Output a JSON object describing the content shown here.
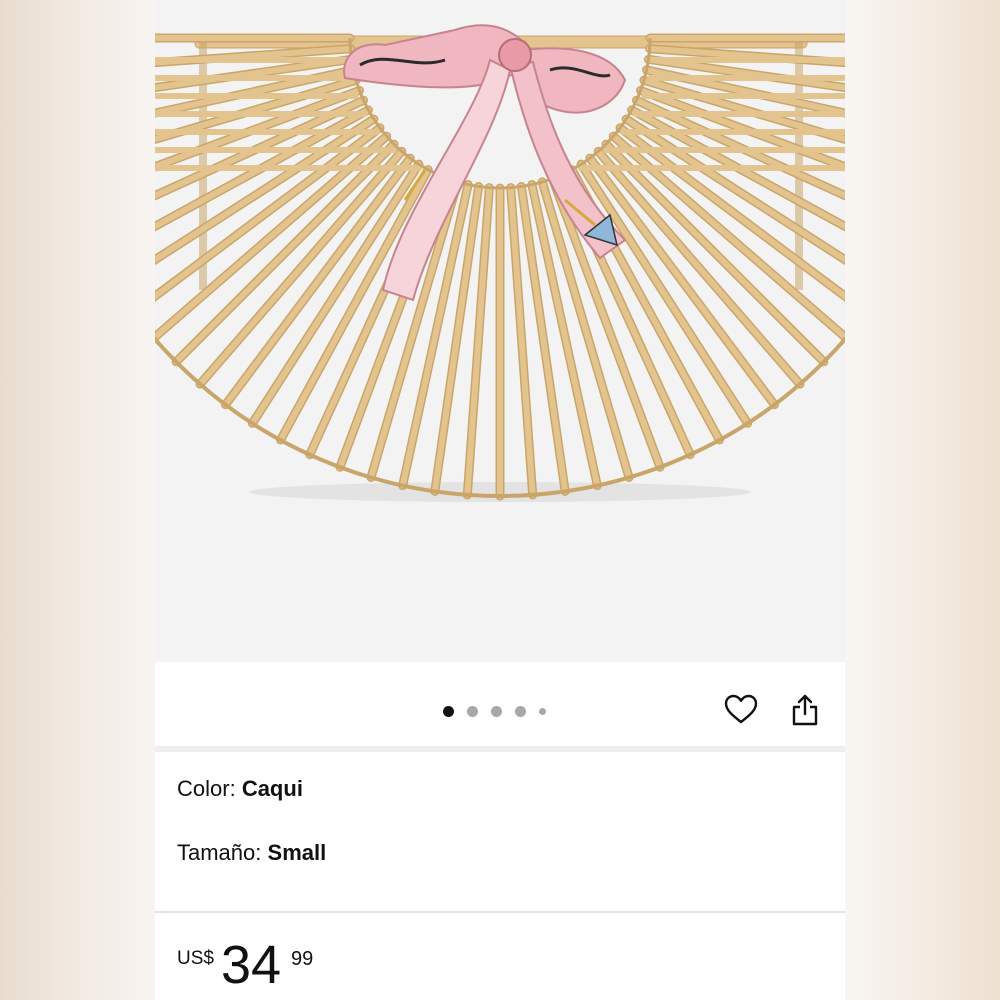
{
  "product": {
    "image_alt": "Bamboo half-moon handbag with pink printed silk scarf bow",
    "carousel": {
      "count": 5,
      "active_index": 0
    }
  },
  "actions": {
    "favorite_icon": "heart-outline-icon",
    "share_icon": "share-upload-icon"
  },
  "attributes": {
    "color_label": "Color:",
    "color_value": "Caqui",
    "size_label": "Tamaño:",
    "size_value": "Small"
  },
  "price": {
    "currency": "US$",
    "whole": "34",
    "fraction": "99"
  },
  "colors": {
    "bamboo": "#e3c48f",
    "bamboo_dark": "#c9a569",
    "scarf_pink": "#f0b7c0",
    "text": "#111111"
  }
}
